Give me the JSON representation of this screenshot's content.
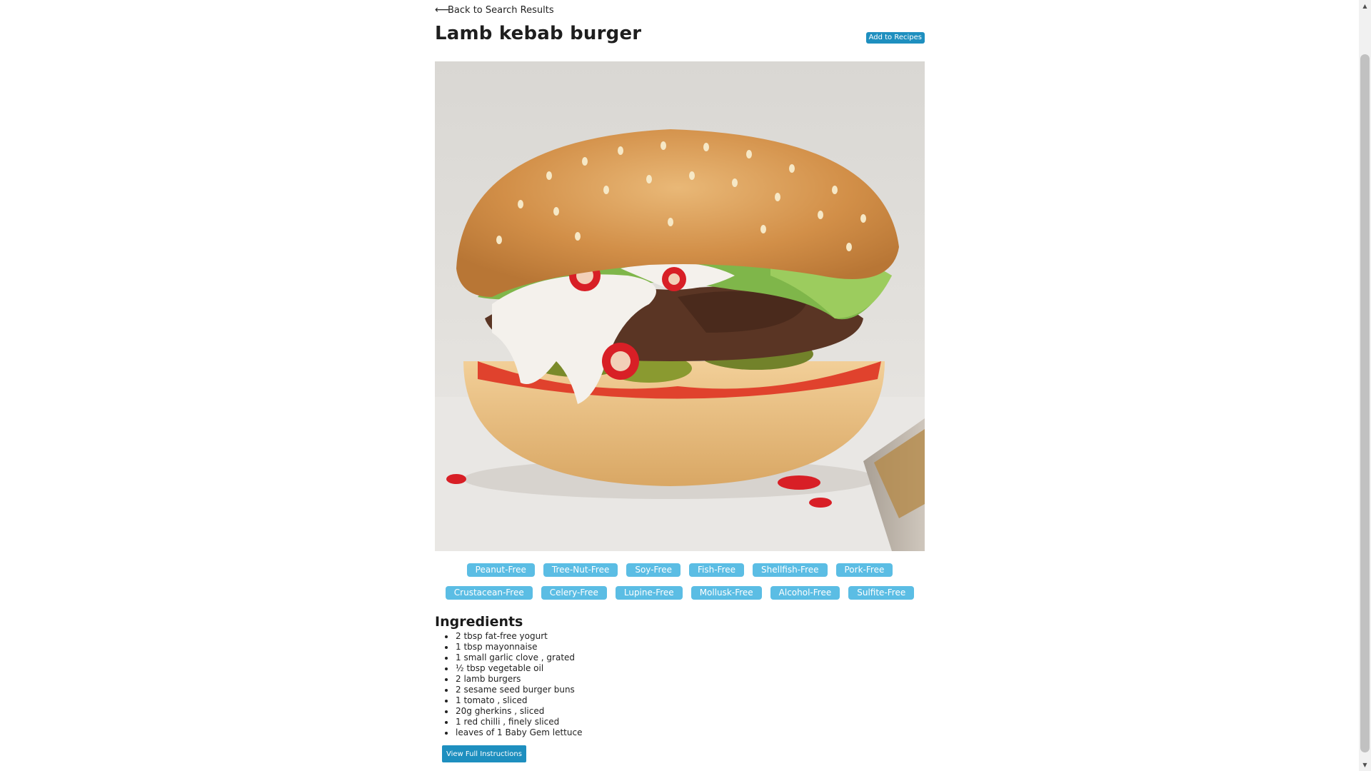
{
  "nav": {
    "back_arrow": "⟵",
    "back_label": "Back to Search Results"
  },
  "recipe": {
    "title": "Lamb kebab burger",
    "add_label": "Add to Recipes"
  },
  "hero_image": {
    "icon": "burger-photo"
  },
  "tags": {
    "row1": [
      "Peanut-Free",
      "Tree-Nut-Free",
      "Soy-Free",
      "Fish-Free",
      "Shellfish-Free",
      "Pork-Free"
    ],
    "row2": [
      "Crustacean-Free",
      "Celery-Free",
      "Lupine-Free",
      "Mollusk-Free",
      "Alcohol-Free",
      "Sulfite-Free"
    ]
  },
  "ingredients": {
    "heading": "Ingredients",
    "items": [
      "2 tbsp fat-free yogurt",
      "1 tbsp mayonnaise",
      "1 small garlic clove , grated",
      "½ tbsp vegetable oil",
      "2 lamb burgers",
      "2 sesame seed burger buns",
      "1 tomato , sliced",
      "20g gherkins , sliced",
      "1 red chilli , finely sliced",
      "leaves of 1 Baby Gem lettuce"
    ]
  },
  "actions": {
    "full_instructions_label": "View Full Instructions"
  },
  "colors": {
    "accent": "#1e8fbf",
    "tag": "#5bbde4"
  }
}
